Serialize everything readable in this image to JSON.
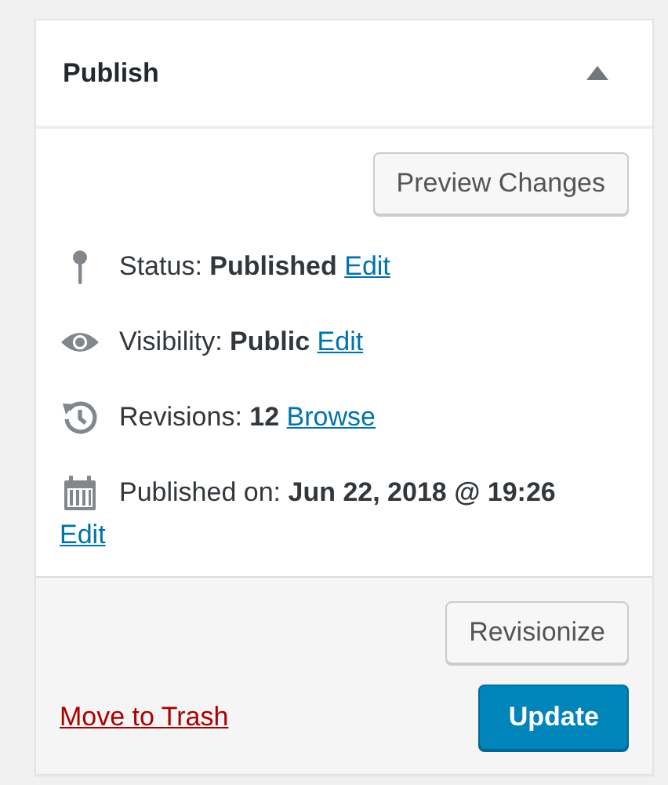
{
  "panel": {
    "title": "Publish",
    "expanded": true
  },
  "preview_button": "Preview Changes",
  "rows": [
    {
      "kind": "status",
      "text": "Status: **Published**",
      "link": "Edit"
    },
    {
      "kind": "visibility",
      "text": "Visibility: **Public**",
      "link": "Edit"
    },
    {
      "kind": "revisions",
      "text": "Revisions: **12**",
      "link": "Browse"
    },
    {
      "kind": "date",
      "text": "Published on: **Jun 22, 2018 @ 19:26**",
      "link": "Edit"
    }
  ],
  "revisionize_button": "Revisionize",
  "trash_link": "Move to Trash",
  "update_button": "Update"
}
